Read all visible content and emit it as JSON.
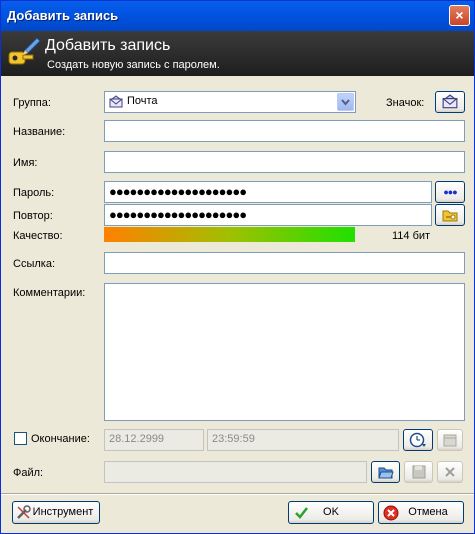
{
  "window": {
    "title": "Добавить запись",
    "close_glyph": "×"
  },
  "banner": {
    "title": "Добавить запись",
    "subtitle": "Создать новую запись с паролем."
  },
  "form": {
    "group_label": "Группа:",
    "group_value": "Почта",
    "icon_label": "Значок:",
    "title_label": "Название:",
    "title_value": "",
    "username_label": "Имя:",
    "username_value": "",
    "password_label": "Пароль:",
    "password_value": "●●●●●●●●●●●●●●●●●●●●",
    "repeat_label": "Повтор:",
    "repeat_value": "●●●●●●●●●●●●●●●●●●●●",
    "show_password_glyph": "●●●",
    "quality_label": "Качество:",
    "quality_text": "114 бит",
    "url_label": "Ссылка:",
    "url_value": "",
    "notes_label": "Комментарии:",
    "notes_value": "",
    "expires_label": "Окончание:",
    "expires_date": "28.12.2999",
    "expires_time": "23:59:59",
    "attachment_label": "Файл:",
    "attachment_value": ""
  },
  "buttons": {
    "tools": "Инструмент",
    "ok": "OK",
    "cancel": "Отмена"
  },
  "colors": {
    "titlebar": "#0054E3",
    "banner": "#2A2A2A",
    "quality_start": "#FF8000",
    "quality_end": "#20E000"
  },
  "icons": {
    "banner": "key-pen-icon",
    "group": "mail-icon",
    "icon_picker": "mail-icon",
    "generate": "folder-key-icon",
    "expiry": "clock-icon",
    "ok": "check-icon",
    "cancel": "cancel-icon"
  }
}
